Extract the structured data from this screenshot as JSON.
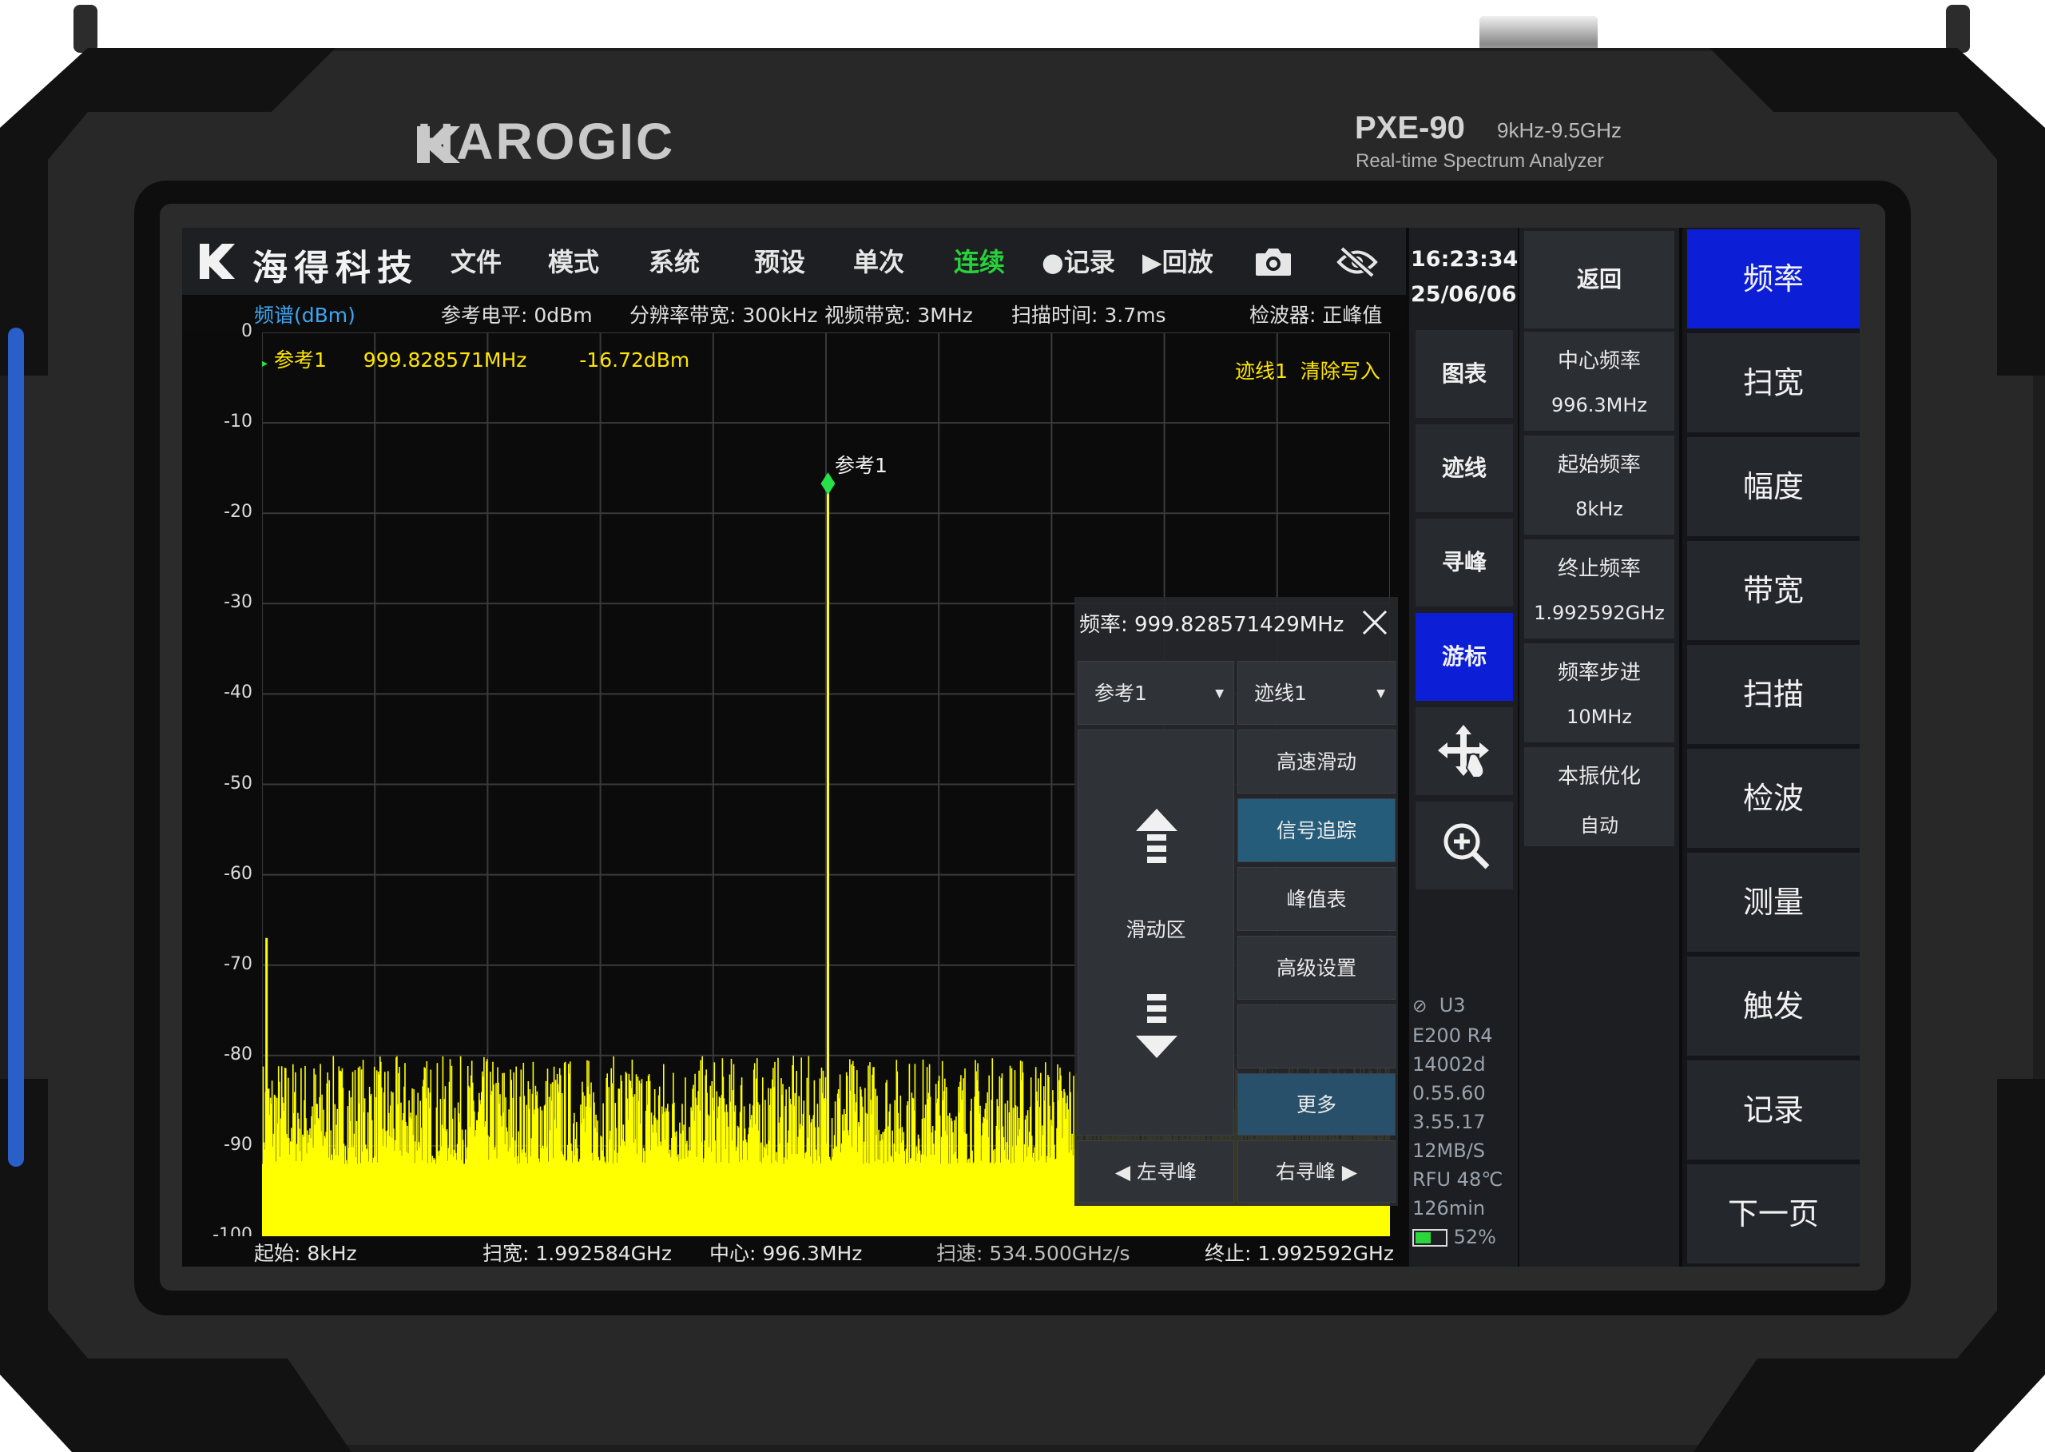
{
  "device": {
    "brand": "HAROGIC",
    "model": "PXE-90",
    "freq_range": "9kHz-9.5GHz",
    "subtitle": "Real-time Spectrum Analyzer"
  },
  "menubar": {
    "logo_text": "海得科技",
    "items": [
      "文件",
      "模式",
      "系统",
      "预设",
      "单次",
      "连续",
      "●记录",
      "▶回放"
    ],
    "active_item": "连续",
    "camera_icon": "camera-icon",
    "hide_icon": "eye-off-icon"
  },
  "infobar": {
    "yaxis_title": "频谱(dBm)",
    "ref_level": "参考电平: 0dBm",
    "rbw": "分辨率带宽: 300kHz",
    "vbw": "视频带宽: 3MHz",
    "sweep_time": "扫描时间: 3.7ms",
    "detector": "检波器: 正峰值"
  },
  "marker_readout": {
    "name": "参考1",
    "freq": "999.828571MHz",
    "level": "-16.72dBm",
    "trace_info": "迹线1  清除写入",
    "peak_label": "参考1"
  },
  "chart_data": {
    "type": "line",
    "ylabel": "频谱(dBm)",
    "yticks": [
      "0",
      "-10",
      "-20",
      "-30",
      "-40",
      "-50",
      "-60",
      "-70",
      "-80",
      "-90",
      "-100"
    ],
    "ylim": [
      -100,
      0
    ],
    "xlim_hz": [
      8000,
      1992592000
    ],
    "grid": true,
    "series": [
      {
        "color": "#ffff00",
        "noise_floor_dbm": [
          -92,
          -80
        ],
        "peaks": [
          {
            "x_mhz": 999.828571,
            "y_dbm": -16.72
          },
          {
            "x_mhz": 8,
            "y_dbm": -67
          }
        ]
      }
    ]
  },
  "bottombar": {
    "start": "起始: 8kHz",
    "span": "扫宽: 1.992584GHz",
    "center": "中心: 996.3MHz",
    "sweep_speed": "扫速: 534.500GHz/s",
    "stop": "终止: 1.992592GHz"
  },
  "popup": {
    "title": "频率: 999.828571429MHz",
    "marker_select": "参考1",
    "trace_select": "迹线1",
    "slide_label": "滑动区",
    "buttons": [
      "高速滑动",
      "信号追踪",
      "峰值表",
      "高级设置",
      "",
      "更多"
    ],
    "left_peak": "◀ 左寻峰",
    "right_peak": "右寻峰 ▶"
  },
  "sidestrip": {
    "time": "16:23:34",
    "date": "25/06/06",
    "buttons": [
      "图表",
      "迹线",
      "寻峰",
      "游标"
    ],
    "selected": "游标",
    "status_lines": [
      "U3",
      "E200 R4",
      "14002d",
      "0.55.60",
      "3.55.17",
      "12MB/S",
      "RFU 48℃",
      "126min"
    ],
    "battery": "52%",
    "battery_fraction": 0.52
  },
  "params": {
    "back": "返回",
    "items": [
      {
        "label": "中心频率",
        "value": "996.3MHz"
      },
      {
        "label": "起始频率",
        "value": "8kHz"
      },
      {
        "label": "终止频率",
        "value": "1.992592GHz"
      },
      {
        "label": "频率步进",
        "value": "10MHz"
      },
      {
        "label": "本振优化",
        "value": "自动"
      }
    ]
  },
  "mainmenu": {
    "items": [
      "频率",
      "扫宽",
      "幅度",
      "带宽",
      "扫描",
      "检波",
      "测量",
      "触发",
      "记录",
      "下一页"
    ],
    "selected": "频率"
  },
  "colors": {
    "trace": "#ffff00",
    "accent_blue": "#0d1fd6",
    "active_menu": "#27d23a",
    "marker": "#28e04a"
  }
}
